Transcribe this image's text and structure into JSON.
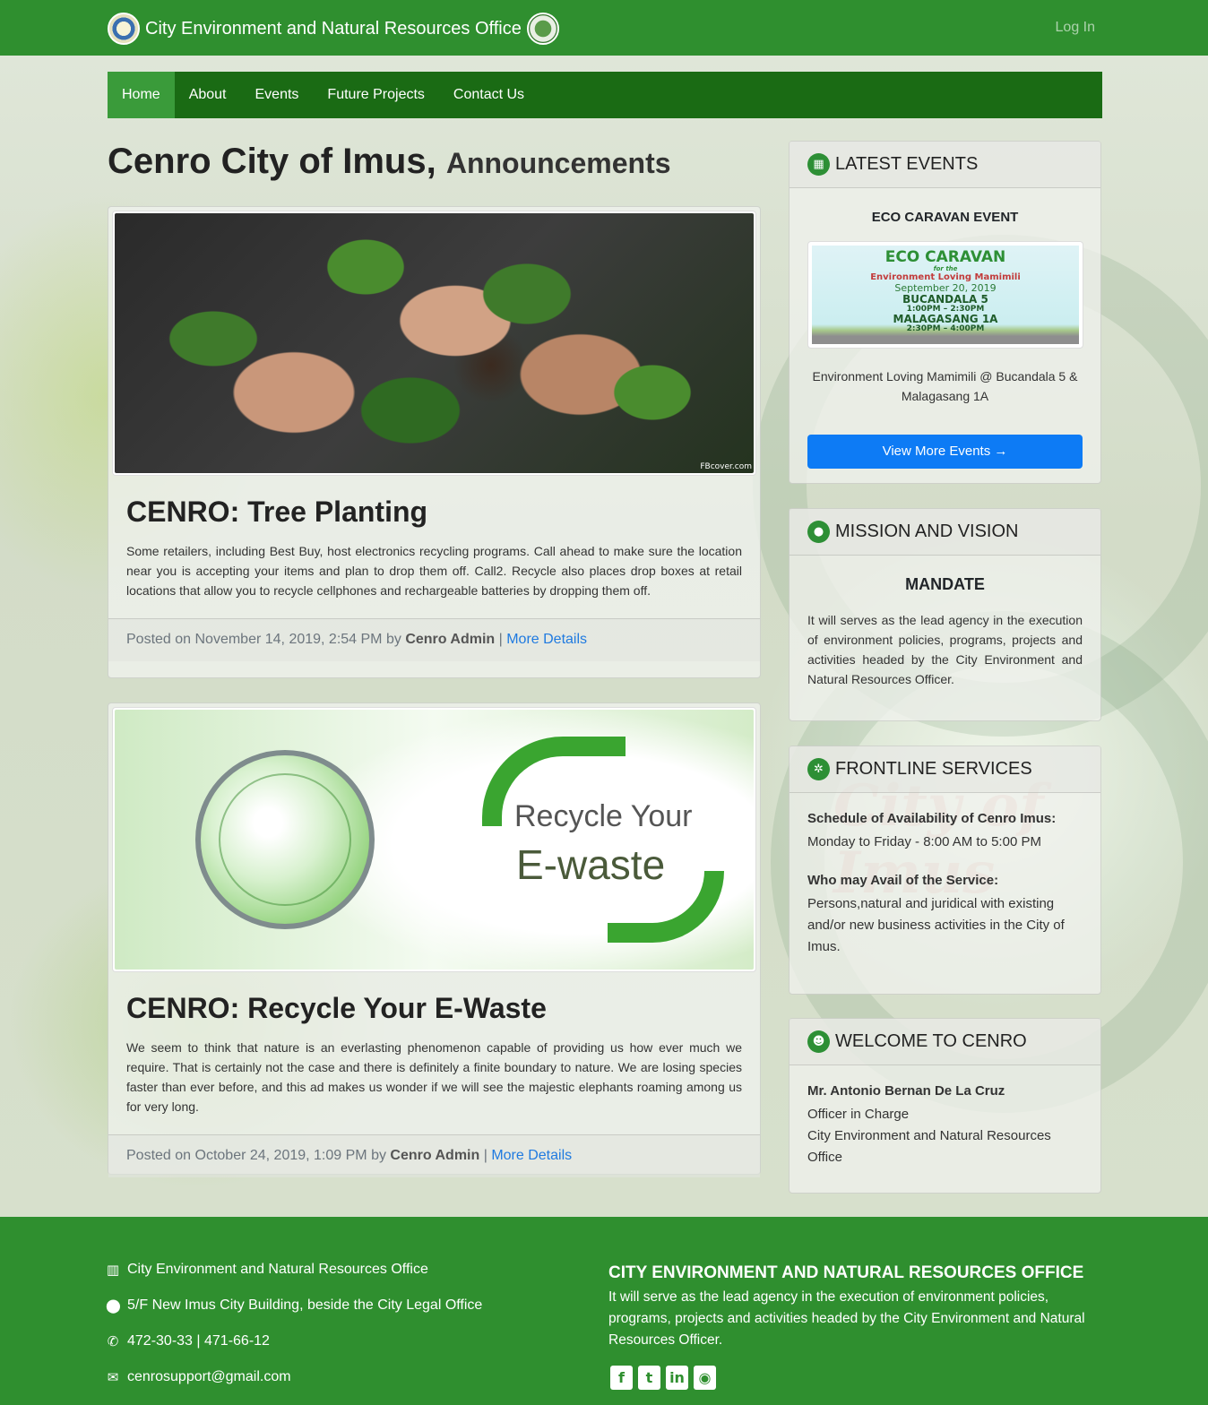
{
  "header": {
    "title": "City Environment and Natural Resources Office",
    "login_label": "Log In"
  },
  "nav": {
    "items": [
      "Home",
      "About",
      "Events",
      "Future Projects",
      "Contact Us"
    ],
    "active": "Home"
  },
  "page": {
    "title": "Cenro City of Imus,",
    "subtitle": "Announcements"
  },
  "posts": [
    {
      "title": "CENRO: Tree Planting",
      "body": "Some retailers, including Best Buy, host electronics recycling programs. Call ahead to make sure the location near you is accepting your items and plan to drop them off. Call2. Recycle also places drop boxes at retail locations that allow you to recycle cellphones and rechargeable batteries by dropping them off.",
      "posted_prefix": "Posted on November 14, 2019, 2:54 PM by",
      "author": "Cenro Admin",
      "link_label": "More Details",
      "image_watermark": "FBcover.com"
    },
    {
      "title": "CENRO: Recycle Your E-Waste",
      "body": "We seem to think that nature is an everlasting phenomenon capable of providing us how ever much we require. That is certainly not the case and there is definitely a finite boundary to nature. We are losing species faster than ever before, and this ad makes us wonder if we will see the majestic elephants roaming among us for very long.",
      "posted_prefix": "Posted on October 24, 2019, 1:09 PM by",
      "author": "Cenro Admin",
      "link_label": "More Details",
      "image_text_1": "Recycle Your",
      "image_text_2": "E-waste"
    }
  ],
  "sidebar": {
    "events": {
      "header": "LATEST EVENTS",
      "event_name": "ECO CARAVAN EVENT",
      "poster": {
        "line1": "ECO CARAVAN",
        "line2": "for the",
        "line3": "Environment Loving Mamimili",
        "line4": "September 20, 2019",
        "line5": "BUCANDALA 5",
        "line6": "1:00PM – 2:30PM",
        "line7": "MALAGASANG 1A",
        "line8": "2:30PM – 4:00PM"
      },
      "description": "Environment Loving Mamimili @ Bucandala 5 & Malagasang 1A",
      "button_label": "View More Events →"
    },
    "mission": {
      "header": "MISSION AND VISION",
      "subheader": "MANDATE",
      "text": "It will serves as the lead agency in the execution of environment policies, programs, projects and activities headed by the City Environment and Natural Resources Officer."
    },
    "frontline": {
      "header": "FRONTLINE SERVICES",
      "label1": "Schedule of Availability of Cenro Imus:",
      "text1": "Monday to Friday - 8:00 AM to 5:00 PM",
      "label2": "Who may Avail of the Service:",
      "text2": "Persons,natural and juridical with existing and/or new business activities in the City of Imus."
    },
    "welcome": {
      "header": "WELCOME TO CENRO",
      "name": "Mr. Antonio Bernan De La Cruz",
      "role": "Officer in Charge",
      "office": "City Environment and Natural Resources Office"
    }
  },
  "footer": {
    "office": "City Environment and Natural Resources Office",
    "address": "5/F New Imus City Building, beside the City Legal Office",
    "phone": "472-30-33 | 471-66-12",
    "email": "cenrosupport@gmail.com",
    "title": "CITY ENVIRONMENT AND NATURAL RESOURCES OFFICE",
    "text": "It will serve as the lead agency in the execution of environment policies, programs, projects and activities headed by the City Environment and Natural Resources Officer."
  },
  "icons": {
    "office": "building-icon",
    "address": "map-marker-icon",
    "phone": "phone-icon",
    "email": "envelope-icon",
    "social": [
      "facebook-icon",
      "twitter-icon",
      "linkedin-icon",
      "map-pin-icon"
    ]
  },
  "colors": {
    "brand_green": "#2f8f2f",
    "nav_green": "#1a6b14",
    "nav_active": "#3a9b3a",
    "link_blue": "#1f7ae0",
    "button_blue": "#0d7bf5"
  }
}
